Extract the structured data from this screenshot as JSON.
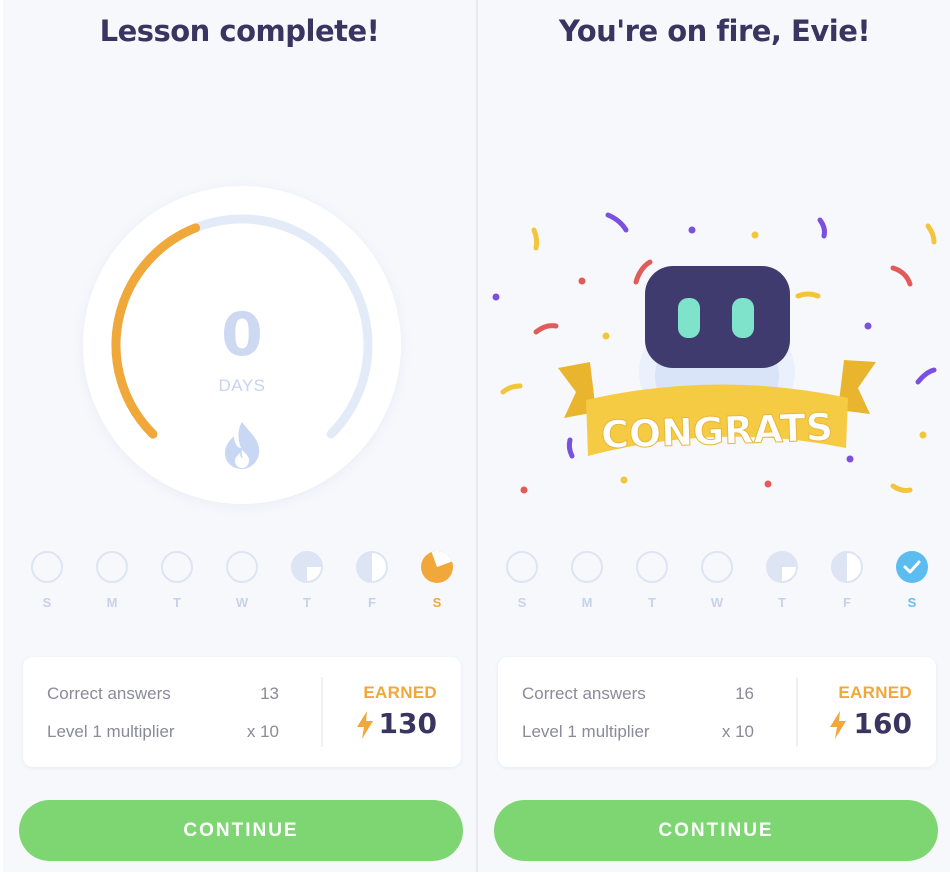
{
  "colors": {
    "accent_orange": "#f0a83a",
    "button_green": "#7ed673",
    "title_navy": "#3a3560",
    "check_blue": "#5bbcf0"
  },
  "left": {
    "title": "Lesson complete!",
    "streak_days": "0",
    "days_label": "DAYS",
    "streak_progress": 0.42,
    "week": [
      {
        "letter": "S",
        "state": "empty"
      },
      {
        "letter": "M",
        "state": "empty"
      },
      {
        "letter": "T",
        "state": "empty"
      },
      {
        "letter": "W",
        "state": "empty"
      },
      {
        "letter": "T",
        "state": "partial"
      },
      {
        "letter": "F",
        "state": "half"
      },
      {
        "letter": "S",
        "state": "active"
      }
    ],
    "summary": {
      "correct_label": "Correct answers",
      "correct_value": "13",
      "multiplier_label": "Level 1 multiplier",
      "multiplier_value": "x 10",
      "earned_label": "EARNED",
      "earned_value": "130"
    },
    "continue_label": "CONTINUE"
  },
  "right": {
    "title": "You're on fire, Evie!",
    "banner_text": "CONGRATS",
    "week": [
      {
        "letter": "S",
        "state": "empty"
      },
      {
        "letter": "M",
        "state": "empty"
      },
      {
        "letter": "T",
        "state": "empty"
      },
      {
        "letter": "W",
        "state": "empty"
      },
      {
        "letter": "T",
        "state": "partial"
      },
      {
        "letter": "F",
        "state": "half"
      },
      {
        "letter": "S",
        "state": "checked"
      }
    ],
    "summary": {
      "correct_label": "Correct answers",
      "correct_value": "16",
      "multiplier_label": "Level 1 multiplier",
      "multiplier_value": "x 10",
      "earned_label": "EARNED",
      "earned_value": "160"
    },
    "continue_label": "CONTINUE"
  }
}
